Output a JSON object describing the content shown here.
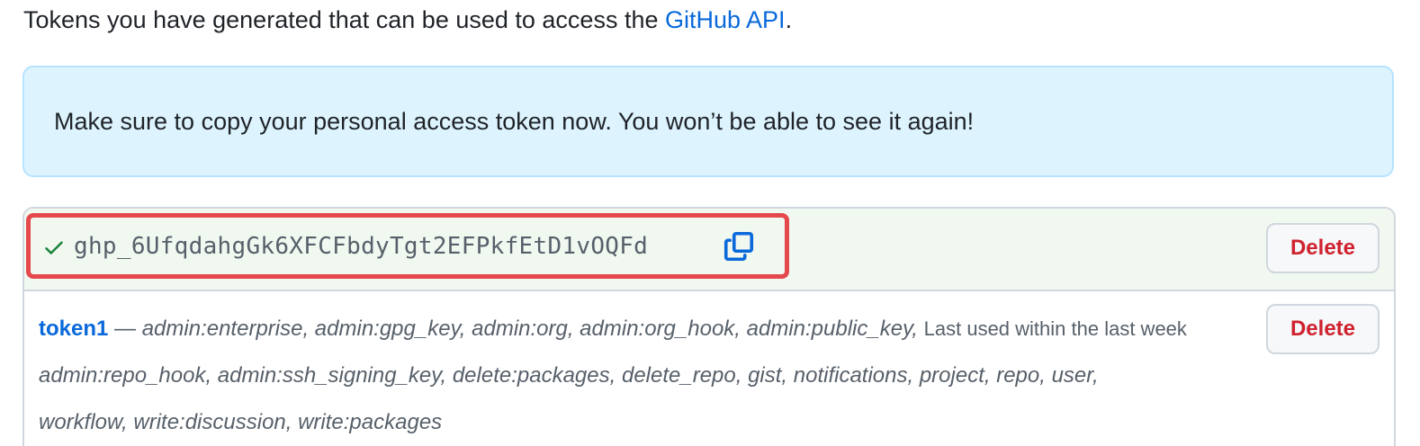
{
  "intro": {
    "text_before": "Tokens you have generated that can be used to access the ",
    "link_text": "GitHub API",
    "text_after": "."
  },
  "flash": {
    "message": "Make sure to copy your personal access token now. You won’t be able to see it again!"
  },
  "new_token": {
    "value": "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",
    "check_icon": "check-icon",
    "copy_icon": "copy-icon",
    "delete_label": "Delete"
  },
  "tokens": [
    {
      "name": "token1",
      "separator": " — ",
      "scopes_part1": "admin:enterprise, admin:gpg_key, admin:org, admin:org_hook, admin:public_key,",
      "last_used": "Last used within the last week",
      "scopes_part2": "admin:repo_hook, admin:ssh_signing_key, delete:packages, delete_repo, gist, notifications, project, repo, user,",
      "scopes_part3": "workflow, write:discussion, write:packages",
      "delete_label": "Delete"
    }
  ],
  "colors": {
    "link": "#0969da",
    "danger": "#cf222e",
    "flash_bg": "#ddf4ff",
    "success_bg": "#f0f8f0",
    "highlight": "#e5484d",
    "check": "#1a7f37"
  }
}
